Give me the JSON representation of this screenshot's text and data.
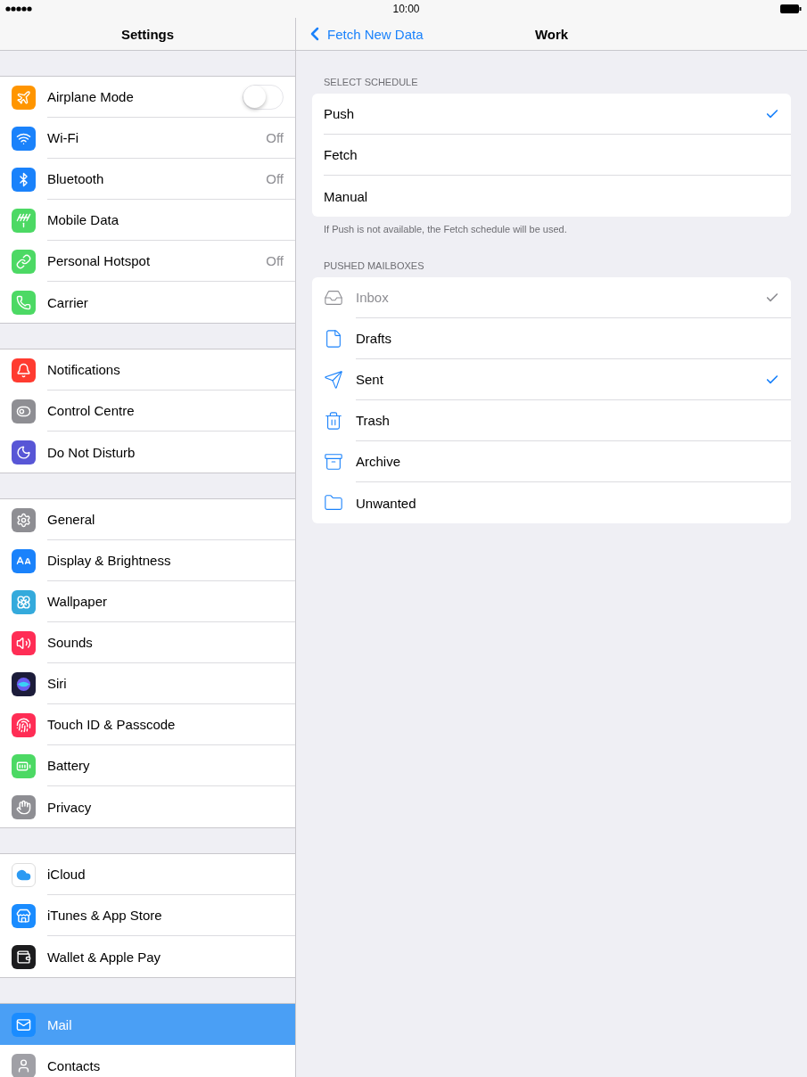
{
  "status_bar": {
    "time": "10:00"
  },
  "sidebar": {
    "title": "Settings",
    "groups": [
      {
        "items": [
          {
            "label": "Airplane Mode",
            "color": "#ff9500",
            "kind": "switch",
            "on": false,
            "selected": false
          },
          {
            "label": "Wi-Fi",
            "color": "#1a82fb",
            "kind": "link",
            "value": "Off",
            "selected": false
          },
          {
            "label": "Bluetooth",
            "color": "#1a82fb",
            "kind": "link",
            "value": "Off",
            "selected": false
          },
          {
            "label": "Mobile Data",
            "color": "#4cd964",
            "kind": "link",
            "selected": false
          },
          {
            "label": "Personal Hotspot",
            "color": "#4cd964",
            "kind": "link",
            "value": "Off",
            "selected": false
          },
          {
            "label": "Carrier",
            "color": "#4cd964",
            "kind": "link",
            "selected": false
          }
        ]
      },
      {
        "items": [
          {
            "label": "Notifications",
            "color": "#ff3b30",
            "kind": "link",
            "selected": false
          },
          {
            "label": "Control Centre",
            "color": "#8e8e93",
            "kind": "link",
            "selected": false
          },
          {
            "label": "Do Not Disturb",
            "color": "#5856d6",
            "kind": "link",
            "selected": false
          }
        ]
      },
      {
        "items": [
          {
            "label": "General",
            "color": "#8e8e93",
            "kind": "link",
            "selected": false
          },
          {
            "label": "Display & Brightness",
            "color": "#1a82fb",
            "kind": "link",
            "selected": false
          },
          {
            "label": "Wallpaper",
            "color": "#34aadc",
            "kind": "link",
            "selected": false
          },
          {
            "label": "Sounds",
            "color": "#ff2d55",
            "kind": "link",
            "selected": false
          },
          {
            "label": "Siri",
            "color": "#1c1c3a",
            "kind": "link",
            "selected": false
          },
          {
            "label": "Touch ID & Passcode",
            "color": "#ff2d55",
            "kind": "link",
            "selected": false
          },
          {
            "label": "Battery",
            "color": "#4cd964",
            "kind": "link",
            "selected": false
          },
          {
            "label": "Privacy",
            "color": "#8e8e93",
            "kind": "link",
            "selected": false
          }
        ]
      },
      {
        "items": [
          {
            "label": "iCloud",
            "color": "#ffffff",
            "kind": "link",
            "selected": false
          },
          {
            "label": "iTunes & App Store",
            "color": "#1a8cff",
            "kind": "link",
            "selected": false
          },
          {
            "label": "Wallet & Apple Pay",
            "color": "#1c1c1e",
            "kind": "link",
            "selected": false
          }
        ]
      },
      {
        "items": [
          {
            "label": "Mail",
            "color": "#1a8cff",
            "kind": "link",
            "selected": true
          },
          {
            "label": "Contacts",
            "color": "#a0a0a6",
            "kind": "link",
            "selected": false
          }
        ]
      }
    ]
  },
  "detail": {
    "back": "Fetch New Data",
    "title": "Work",
    "sections": [
      {
        "header": "SELECT SCHEDULE",
        "footer": "If Push is not available, the Fetch schedule will be used.",
        "rows": [
          {
            "label": "Push",
            "checked": true,
            "disabled": false
          },
          {
            "label": "Fetch",
            "checked": false,
            "disabled": false
          },
          {
            "label": "Manual",
            "checked": false,
            "disabled": false
          }
        ]
      },
      {
        "header": "PUSHED MAILBOXES",
        "rows": [
          {
            "label": "Inbox",
            "checked": true,
            "disabled": true
          },
          {
            "label": "Drafts",
            "checked": false,
            "disabled": false
          },
          {
            "label": "Sent",
            "checked": true,
            "disabled": false
          },
          {
            "label": "Trash",
            "checked": false,
            "disabled": false
          },
          {
            "label": "Archive",
            "checked": false,
            "disabled": false
          },
          {
            "label": "Unwanted",
            "checked": false,
            "disabled": false
          }
        ]
      }
    ]
  }
}
